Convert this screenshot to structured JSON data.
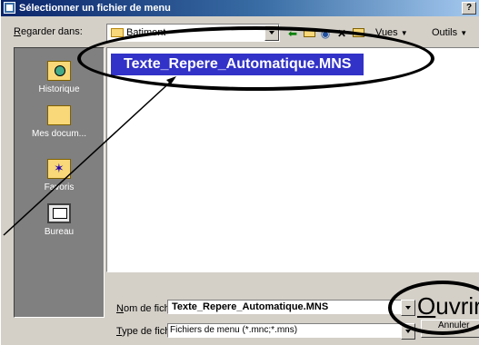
{
  "window": {
    "title": "Sélectionner un fichier de menu",
    "help_label": "?"
  },
  "toolbar": {
    "look_in_label_first": "R",
    "look_in_label_rest": "egarder dans:",
    "look_in_value": "Batiment",
    "views_label_first": "V",
    "views_label_rest": "ues",
    "tools_label": "Outils"
  },
  "places": [
    {
      "label": "Historique",
      "icon": "history-icon"
    },
    {
      "label": "Mes docum...",
      "icon": "my-documents-icon"
    },
    {
      "label": "Favoris",
      "icon": "favorites-icon"
    },
    {
      "label": "Bureau",
      "icon": "desktop-icon"
    }
  ],
  "files": [
    {
      "name": "Texte_Repere_Automatique.MNS",
      "selected": true
    }
  ],
  "form": {
    "filename_label_first": "N",
    "filename_label_rest": "om de fichier:",
    "filename_value": "Texte_Repere_Automatique.MNS",
    "filetype_label_first": "T",
    "filetype_label_rest": "ype de fichier:",
    "filetype_value": "Fichiers de menu (*.mnc;*.mns)",
    "open_label_first": "O",
    "open_label_rest": "uvrir",
    "cancel_label": "Annuler"
  },
  "colors": {
    "selection": "#3232c8",
    "title_start": "#0a246a",
    "title_end": "#a6caf0"
  }
}
